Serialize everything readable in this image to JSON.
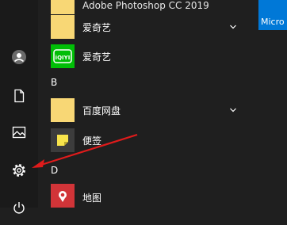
{
  "apps": {
    "top_item": {
      "label": "Adobe Photoshop CC 2019"
    },
    "aiqiyi_folder": {
      "label": "爱奇艺"
    },
    "aiqiyi_app": {
      "label": "爱奇艺",
      "logo_text": "iQIYI"
    },
    "section_b": "B",
    "baidu_folder": {
      "label": "百度网盘"
    },
    "sticky_notes": {
      "label": "便签"
    },
    "section_d": "D",
    "maps": {
      "label": "地图"
    }
  },
  "tile": {
    "label": "Micro"
  },
  "colors": {
    "accent": "#0078d7",
    "folder": "#f8d775",
    "iqiyi_green": "#00be06",
    "sticky_yellow": "#f8e44b",
    "maps_red": "#d13438",
    "arrow": "#e01b1b"
  },
  "icons": {
    "rail": [
      "user-icon",
      "document-icon",
      "pictures-icon",
      "settings-gear-icon",
      "power-icon"
    ]
  }
}
